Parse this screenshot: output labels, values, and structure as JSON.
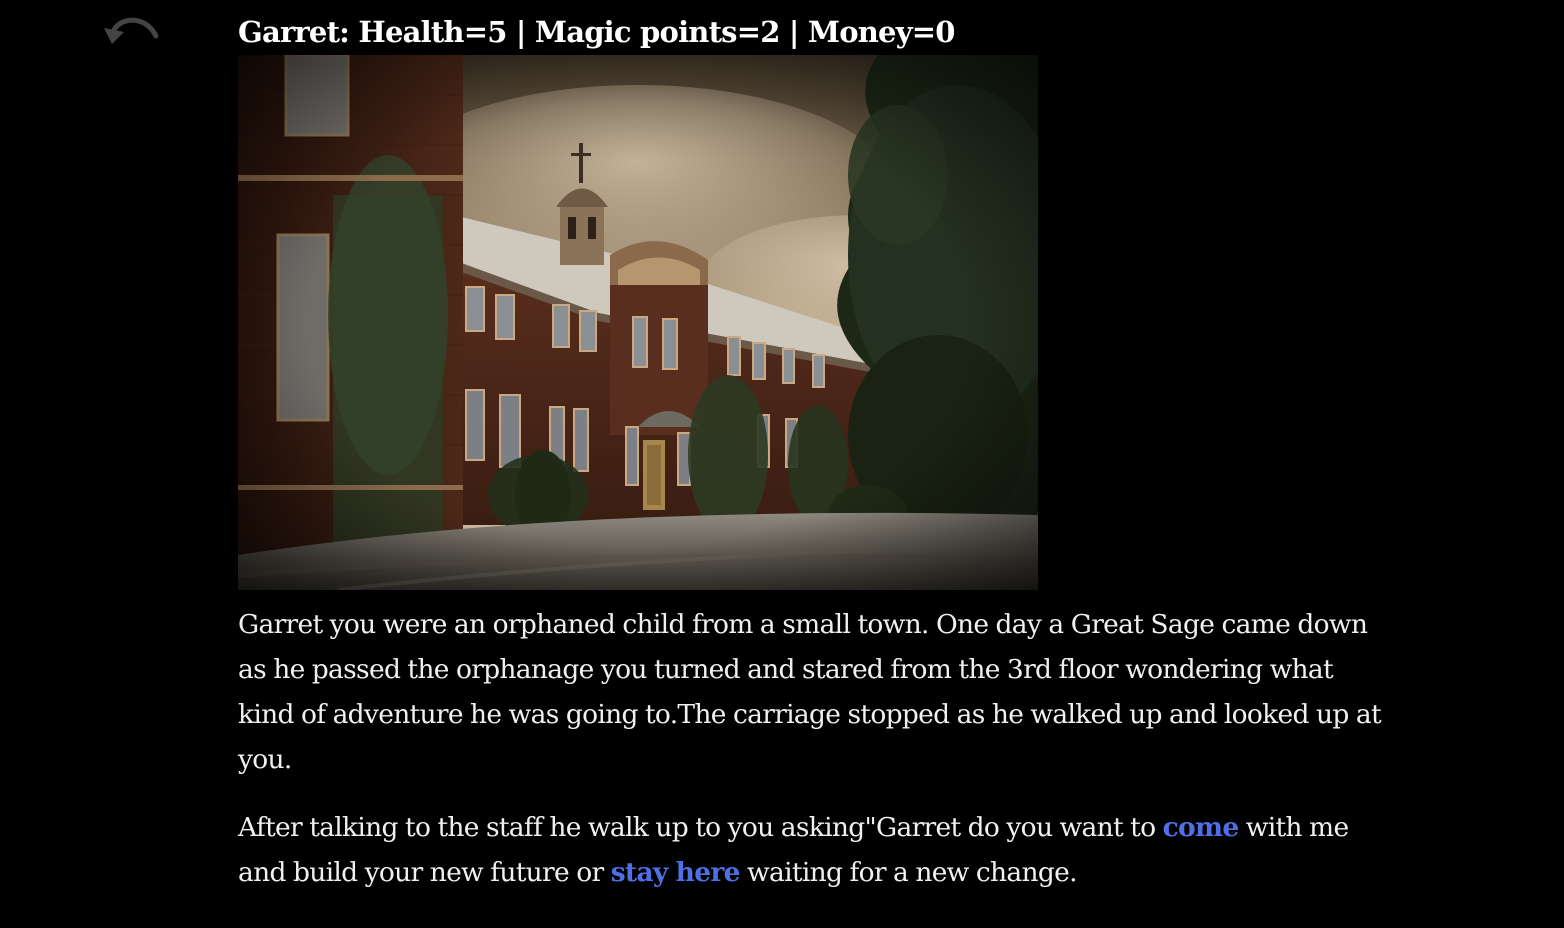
{
  "controls": {
    "undo_icon": "undo-arrow-icon"
  },
  "stats": {
    "text": "Garret: Health=5 | Magic points=2 | Money=0"
  },
  "scene": {
    "description_icon": "orphanage-building-image"
  },
  "story": {
    "paragraph1": "Garret you were an orphaned child from a small town. One day a Great Sage came down as he passed the orphanage you turned and stared from the 3rd floor wondering what kind of adventure he was going to.The carriage stopped as he walked up and looked up at you.",
    "p2_part1": "After talking to the staff he walk up to you asking\"Garret do you want to ",
    "link_come": "come",
    "p2_part2": " with me and build your new future or ",
    "link_stay": "stay here",
    "p2_part3": " waiting for a new change."
  },
  "colors": {
    "background": "#000000",
    "text": "#f0f0f0",
    "link": "#4f6fe6",
    "undo_icon": "#444444"
  }
}
